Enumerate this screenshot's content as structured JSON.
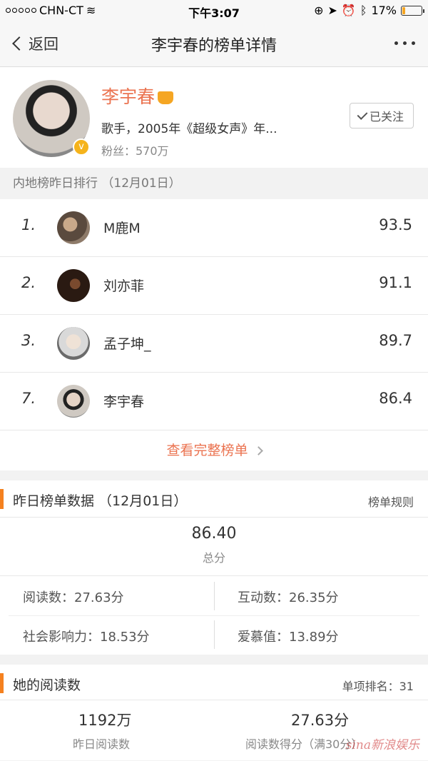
{
  "status": {
    "carrier": "CHN-CT",
    "time": "下午3:07",
    "battery_percent": "17%",
    "battery_level": 0.17
  },
  "nav": {
    "back_label": "返回",
    "title": "李宇春的榜单详情"
  },
  "profile": {
    "name": "李宇春",
    "intro": "歌手，2005年《超级女声》年...",
    "fans": "粉丝：570万",
    "follow_label": "已关注"
  },
  "rank": {
    "header": "内地榜昨日排行 （12月01日）",
    "rows": [
      {
        "num": "1.",
        "name": "M鹿M",
        "score": "93.5"
      },
      {
        "num": "2.",
        "name": "刘亦菲",
        "score": "91.1"
      },
      {
        "num": "3.",
        "name": "孟子坤_",
        "score": "89.7"
      },
      {
        "num": "7.",
        "name": "李宇春",
        "score": "86.4"
      }
    ],
    "view_all": "查看完整榜单"
  },
  "yesterday": {
    "title": "昨日榜单数据 （12月01日）",
    "rules": "榜单规则",
    "total_value": "86.40",
    "total_label": "总分",
    "read": "阅读数：27.63分",
    "interact": "互动数：26.35分",
    "influence": "社会影响力：18.53分",
    "love": "爱慕值：13.89分"
  },
  "reading": {
    "title": "她的阅读数",
    "rank": "单项排名：31",
    "count_value": "1192万",
    "count_label": "昨日阅读数",
    "score_value": "27.63分",
    "score_label": "阅读数得分（满30分）"
  },
  "watermark": "sina新浪娱乐"
}
